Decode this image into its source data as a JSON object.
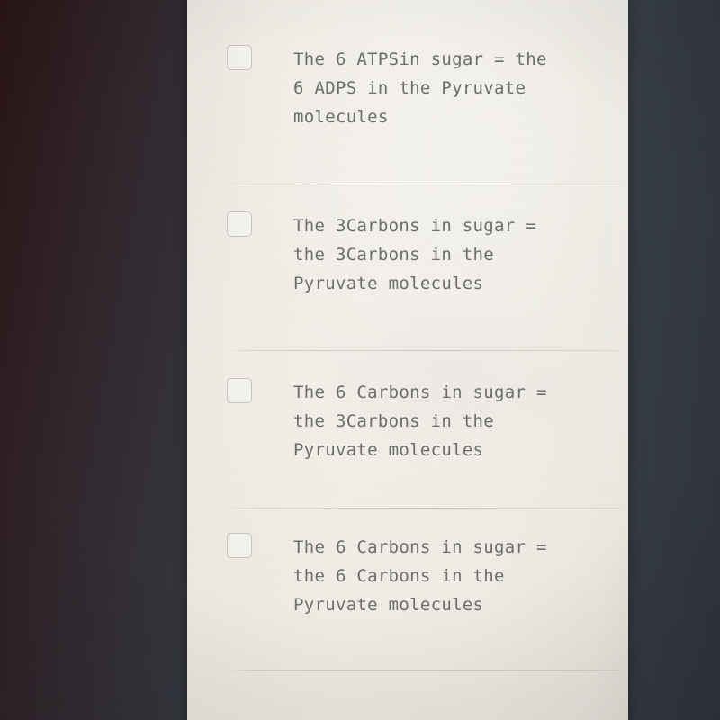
{
  "screen": {
    "kind": "quiz-multiple-choice",
    "background_color": "#efede5",
    "text_color": "#6d6d6d",
    "checkbox_border_color": "#c6c4bd",
    "separator_color": "#aaa69e"
  },
  "photo": {
    "left_backdrop_color": "#2a1518",
    "right_backdrop_color": "#353b43"
  },
  "options": [
    {
      "id": "option-1",
      "checkbox_state": "unchecked",
      "checkbox_icon": "empty-checkbox-icon",
      "text": "The 6 ATPSin sugar = the\n6 ADPS in the Pyruvate\nmolecules"
    },
    {
      "id": "option-2",
      "checkbox_state": "unchecked",
      "checkbox_icon": "empty-checkbox-icon",
      "text": "The 3Carbons in sugar =\nthe 3Carbons in the\nPyruvate molecules"
    },
    {
      "id": "option-3",
      "checkbox_state": "unchecked",
      "checkbox_icon": "empty-checkbox-icon",
      "text": "The 6 Carbons in sugar =\nthe 3Carbons in the\nPyruvate molecules"
    },
    {
      "id": "option-4",
      "checkbox_state": "unchecked",
      "checkbox_icon": "empty-checkbox-icon",
      "text": "The 6 Carbons in sugar =\nthe 6 Carbons in the\nPyruvate molecules"
    }
  ]
}
